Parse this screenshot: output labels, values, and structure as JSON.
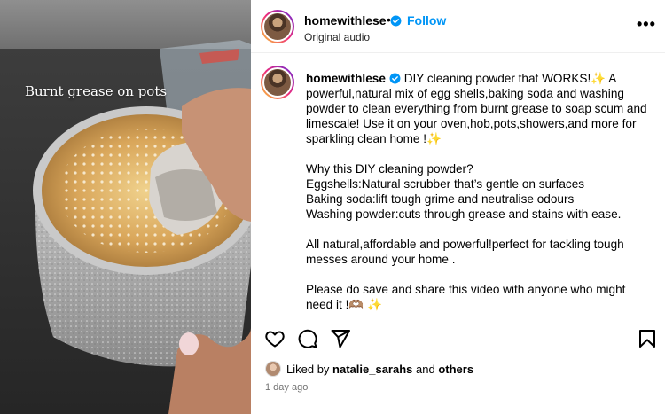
{
  "media": {
    "overlay_text": "Burnt grease on pots"
  },
  "header": {
    "username": "homewithlese",
    "separator": "•",
    "follow_label": "Follow",
    "audio_label": "Original audio",
    "more_icon": "more-horizontal-icon"
  },
  "caption": {
    "username": "homewithlese",
    "intro": "DIY cleaning powder that WORKS!✨ A powerful,natural mix of egg shells,baking soda and washing powder to clean everything from burnt grease to soap scum and limescale! Use it on your oven,hob,pots,showers,and more for sparkling clean home !✨",
    "why_heading": "Why this DIY cleaning powder?",
    "points": [
      "Eggshells:Natural scrubber that’s gentle on surfaces",
      "Baking soda:lift tough grime and neutralise odours",
      "Washing powder:cuts through grease and stains with ease."
    ],
    "summary": "All natural,affordable and powerful!perfect for tackling tough messes around your home .",
    "cta": "Please do save and share this video with anyone who might need it !🫶🏽 ✨"
  },
  "actions": {
    "like_icon": "heart-icon",
    "comment_icon": "comment-icon",
    "share_icon": "share-icon",
    "save_icon": "bookmark-icon",
    "liked_by_prefix": "Liked by",
    "liked_by_user": "natalie_sarahs",
    "liked_by_and": "and",
    "liked_by_others": "others",
    "timestamp": "1 day ago"
  },
  "colors": {
    "accent": "#0095f6",
    "verified": "#0095f6",
    "muted": "#737373"
  }
}
